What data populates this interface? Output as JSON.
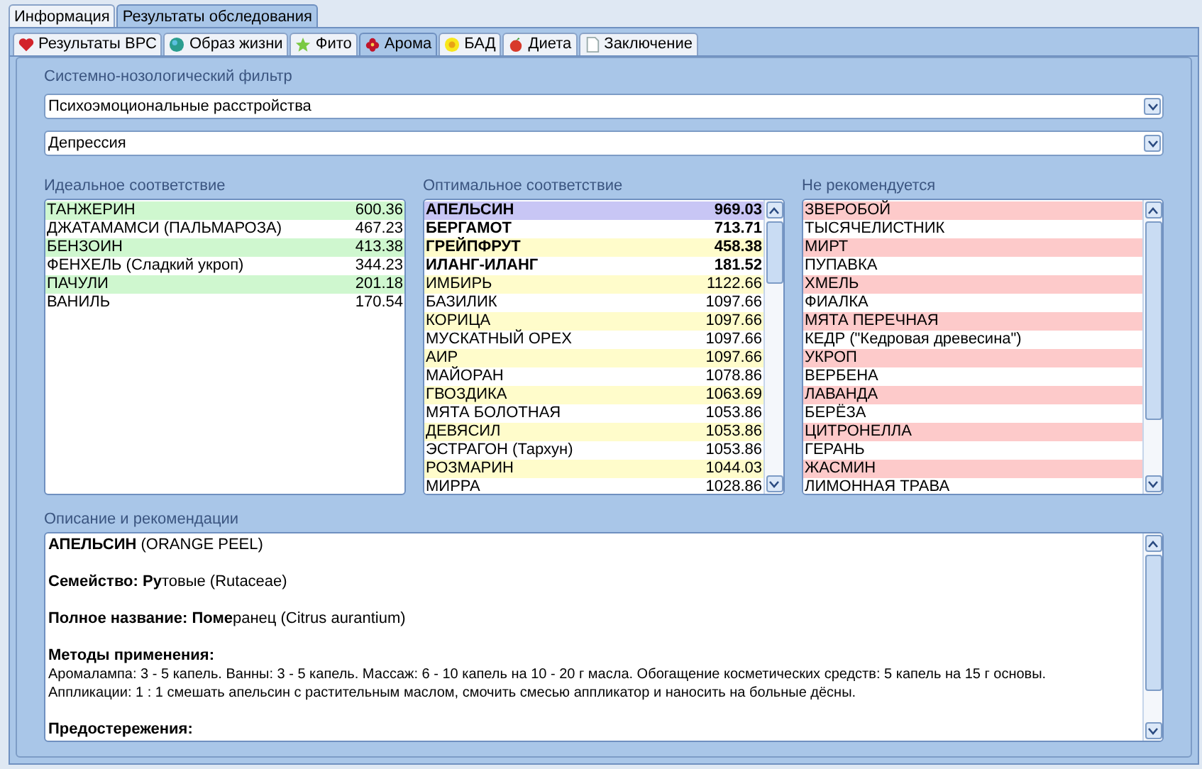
{
  "top_tabs": [
    {
      "label": "Информация",
      "selected": false
    },
    {
      "label": "Результаты обследования",
      "selected": true
    }
  ],
  "sub_tabs": [
    {
      "label": "Результаты ВРС",
      "selected": false
    },
    {
      "label": "Образ жизни",
      "selected": false
    },
    {
      "label": "Фито",
      "selected": false
    },
    {
      "label": "Арома",
      "selected": true
    },
    {
      "label": "БАД",
      "selected": false
    },
    {
      "label": "Диета",
      "selected": false
    },
    {
      "label": "Заключение",
      "selected": false
    }
  ],
  "filter": {
    "label": "Системно-нозологический фильтр",
    "category": "Психоэмоциональные расстройства",
    "condition": "Депрессия"
  },
  "ideal": {
    "title": "Идеальное соответствие",
    "rows": [
      {
        "name": "ТАНЖЕРИН",
        "value": "600.36"
      },
      {
        "name": "ДЖАТАМАМСИ (ПАЛЬМАРОЗА)",
        "value": "467.23"
      },
      {
        "name": "БЕНЗОИН",
        "value": "413.38"
      },
      {
        "name": "ФЕНХЕЛЬ (Сладкий укроп)",
        "value": "344.23"
      },
      {
        "name": "ПАЧУЛИ",
        "value": "201.18"
      },
      {
        "name": "ВАНИЛЬ",
        "value": "170.54"
      }
    ]
  },
  "optimal": {
    "title": "Оптимальное соответствие",
    "rows": [
      {
        "name": "АПЕЛЬСИН",
        "value": "969.03",
        "emphasized": true,
        "selected": true
      },
      {
        "name": "БЕРГАМОТ",
        "value": "713.71",
        "emphasized": true,
        "selected": false
      },
      {
        "name": "ГРЕЙПФРУТ",
        "value": "458.38",
        "emphasized": true,
        "selected": false
      },
      {
        "name": "ИЛАНГ-ИЛАНГ",
        "value": "181.52",
        "emphasized": true,
        "selected": false
      },
      {
        "name": "ИМБИРЬ",
        "value": "1122.66",
        "emphasized": false,
        "selected": false
      },
      {
        "name": "БАЗИЛИК",
        "value": "1097.66",
        "emphasized": false,
        "selected": false
      },
      {
        "name": "КОРИЦА",
        "value": "1097.66",
        "emphasized": false,
        "selected": false
      },
      {
        "name": "МУСКАТНЫЙ ОРЕХ",
        "value": "1097.66",
        "emphasized": false,
        "selected": false
      },
      {
        "name": "АИР",
        "value": "1097.66",
        "emphasized": false,
        "selected": false
      },
      {
        "name": "МАЙОРАН",
        "value": "1078.86",
        "emphasized": false,
        "selected": false
      },
      {
        "name": "ГВОЗДИКА",
        "value": "1063.69",
        "emphasized": false,
        "selected": false
      },
      {
        "name": "МЯТА БОЛОТНАЯ",
        "value": "1053.86",
        "emphasized": false,
        "selected": false
      },
      {
        "name": "ДЕВЯСИЛ",
        "value": "1053.86",
        "emphasized": false,
        "selected": false
      },
      {
        "name": "ЭСТРАГОН (Тархун)",
        "value": "1053.86",
        "emphasized": false,
        "selected": false
      },
      {
        "name": "РОЗМАРИН",
        "value": "1044.03",
        "emphasized": false,
        "selected": false
      },
      {
        "name": "МИРРА",
        "value": "1028.86",
        "emphasized": false,
        "selected": false
      }
    ]
  },
  "not_recommended": {
    "title": "Не рекомендуется",
    "rows": [
      "ЗВЕРОБОЙ",
      "ТЫСЯЧЕЛИСТНИК",
      "МИРТ",
      "ПУПАВКА",
      "ХМЕЛЬ",
      "ФИАЛКА",
      "МЯТА ПЕРЕЧНАЯ",
      "КЕДР (\"Кедровая древесина\")",
      "УКРОП",
      "ВЕРБЕНА",
      "ЛАВАНДА",
      "БЕРЁЗА",
      "ЦИТРОНЕЛЛА",
      "ГЕРАНЬ",
      "ЖАСМИН",
      "ЛИМОННАЯ ТРАВА"
    ]
  },
  "description": {
    "title": "Описание и рекомендации",
    "paragraphs": [
      {
        "kind": "text",
        "lines": [
          "**АПЕЛЬСИН** (ORANGE PEEL)"
        ]
      },
      {
        "kind": "text",
        "lines": [
          "**Семейство: Ру**товые (Rutaceae)"
        ]
      },
      {
        "kind": "text",
        "lines": [
          "**Полное название: Поме**ранец (Citrus aurantium)"
        ]
      },
      {
        "kind": "section",
        "heading": "Методы применения:",
        "lines": [
          "Аромалампа: 3 - 5 капель. Ванны: 3 - 5 капель. Массаж: 6 - 10 капель на 10 - 20 г масла. Обогащение косметических средств: 5 капель на 15 г основы.",
          "Аппликации: 1 : 1 смешать апельсин с растительным маслом, смочить смесью аппликатор и наносить на больные дёсны."
        ]
      },
      {
        "kind": "section",
        "heading": "Предостережения:"
      }
    ]
  }
}
